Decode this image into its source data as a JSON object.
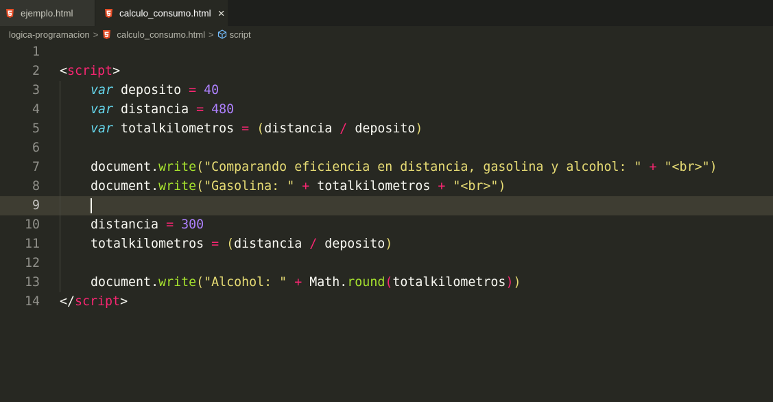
{
  "tabs": [
    {
      "label": "ejemplo.html",
      "active": false
    },
    {
      "label": "calculo_consumo.html",
      "active": true,
      "close": "×"
    }
  ],
  "breadcrumb": {
    "folder": "logica-programacion",
    "file": "calculo_consumo.html",
    "symbol": "script",
    "separator": ">"
  },
  "line_numbers": [
    "1",
    "2",
    "3",
    "4",
    "5",
    "6",
    "7",
    "8",
    "9",
    "10",
    "11",
    "12",
    "13",
    "14"
  ],
  "current_line": "9",
  "code": {
    "l2": {
      "open": "<",
      "tag": "script",
      "close": ">"
    },
    "l3": {
      "kw": "var",
      "name": "deposito",
      "eq": "=",
      "num": "40"
    },
    "l4": {
      "kw": "var",
      "name": "distancia",
      "eq": "=",
      "num": "480"
    },
    "l5": {
      "kw": "var",
      "name": "totalkilometros",
      "eq": "=",
      "lp": "(",
      "a": "distancia",
      "div": "/",
      "b": "deposito",
      "rp": ")"
    },
    "l7": {
      "obj": "document",
      "dot": ".",
      "fn": "write",
      "lp": "(",
      "s1": "\"Comparando eficiencia en distancia, gasolina y alcohol: \"",
      "plus": "+",
      "s2": "\"<br>\"",
      "rp": ")"
    },
    "l8": {
      "obj": "document",
      "dot": ".",
      "fn": "write",
      "lp": "(",
      "s1": "\"Gasolina: \"",
      "plus1": "+",
      "v": "totalkilometros",
      "plus2": "+",
      "s2": "\"<br>\"",
      "rp": ")"
    },
    "l10": {
      "name": "distancia",
      "eq": "=",
      "num": "300"
    },
    "l11": {
      "name": "totalkilometros",
      "eq": "=",
      "lp": "(",
      "a": "distancia",
      "div": "/",
      "b": "deposito",
      "rp": ")"
    },
    "l13": {
      "obj": "document",
      "dot": ".",
      "fn": "write",
      "lp": "(",
      "s1": "\"Alcohol: \"",
      "plus": "+",
      "math": "Math",
      "dot2": ".",
      "fn2": "round",
      "lp2": "(",
      "v": "totalkilometros",
      "rp2": ")",
      "rp": ")"
    },
    "l14": {
      "open": "</",
      "tag": "script",
      "close": ">"
    }
  },
  "colors": {
    "background": "#272822",
    "keyword": "#66d9ef",
    "tag": "#f92672",
    "number": "#ae81ff",
    "function": "#a6e22e",
    "string": "#e6db74",
    "html_icon": "#e44d26"
  },
  "icons": {
    "file": "html5-icon",
    "symbol": "cube-icon",
    "close": "close-icon"
  }
}
